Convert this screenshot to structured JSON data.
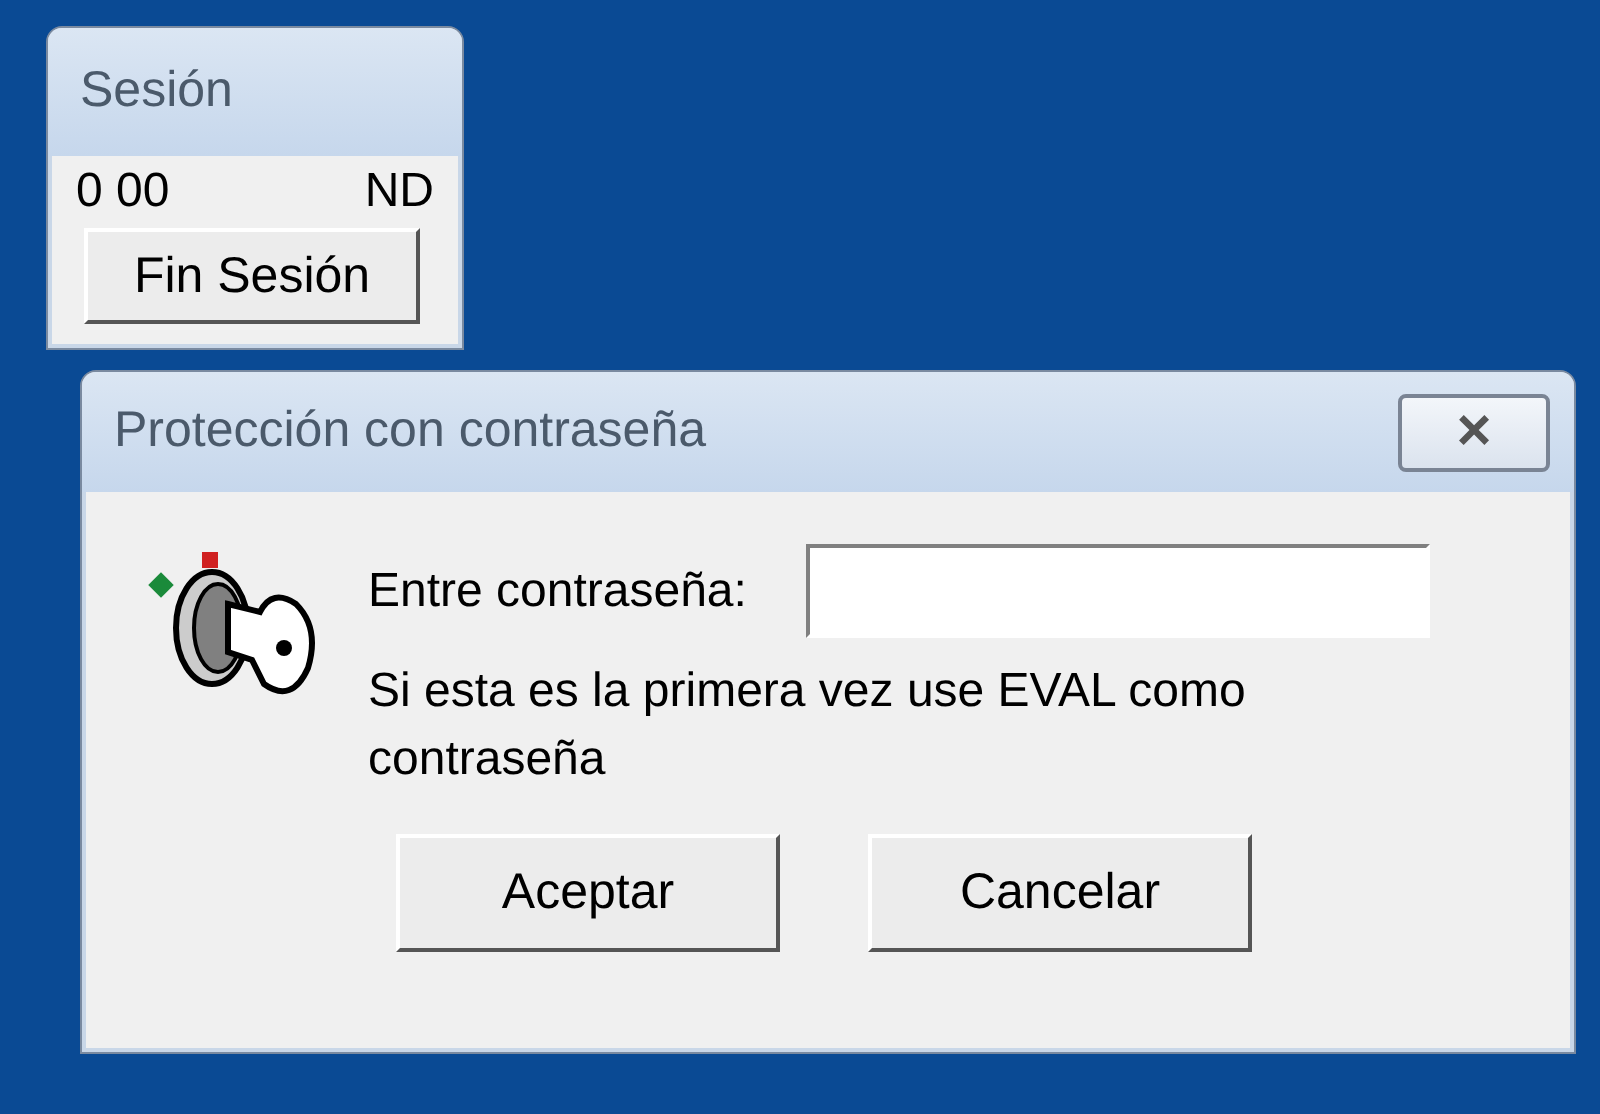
{
  "session_window": {
    "title": "Sesión",
    "time": "0 00",
    "status": "ND",
    "button": "Fin Sesión"
  },
  "dialog": {
    "title": "Protección con contraseña",
    "close": "×",
    "password_label": "Entre contraseña:",
    "hint": "Si esta es la primera vez use EVAL como contraseña",
    "buttons": [
      "Aceptar",
      "Cancelar"
    ]
  }
}
